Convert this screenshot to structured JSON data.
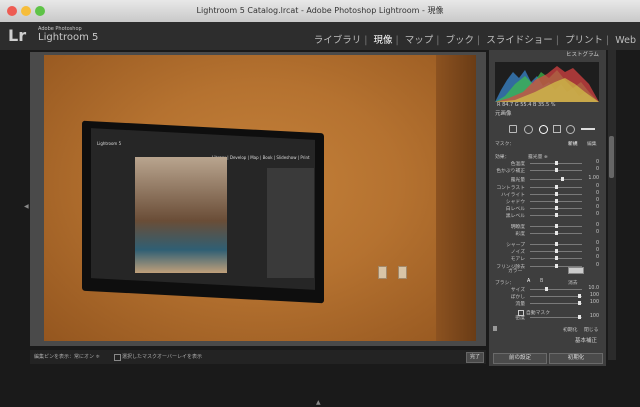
{
  "window": {
    "title": "Lightroom 5 Catalog.lrcat - Adobe Photoshop Lightroom - 現像"
  },
  "brand": {
    "small": "Adobe Photoshop",
    "big": "Lightroom 5",
    "logo": "Lr"
  },
  "modules": [
    "ライブラリ",
    "現像",
    "マップ",
    "ブック",
    "スライドショー",
    "プリント",
    "Web"
  ],
  "active_module": "現像",
  "panel": {
    "histogram_title": "ヒストグラム",
    "readout": "R 84.7  G 55.4  B 35.5 %",
    "smart_preview": "元画像",
    "mask_label": "マスク：",
    "mask_new": "新規",
    "mask_edit": "編集",
    "effect_label": "効果：",
    "effect_value": "露光量 ≑",
    "sliders": [
      {
        "label": "色温度",
        "value": "0"
      },
      {
        "label": "色かぶり補正",
        "value": "0"
      },
      {
        "label": "露光量",
        "value": "1.00"
      },
      {
        "label": "コントラスト",
        "value": "0"
      },
      {
        "label": "ハイライト",
        "value": "0"
      },
      {
        "label": "シャドウ",
        "value": "0"
      },
      {
        "label": "白レベル",
        "value": "0"
      },
      {
        "label": "黒レベル",
        "value": "0"
      },
      {
        "label": "明瞭度",
        "value": "0"
      },
      {
        "label": "彩度",
        "value": "0"
      },
      {
        "label": "シャープ",
        "value": "0"
      },
      {
        "label": "ノイズ",
        "value": "0"
      },
      {
        "label": "モアレ",
        "value": "0"
      },
      {
        "label": "フリンジ除去",
        "value": "0"
      }
    ],
    "color_label": "カラー",
    "brush_label": "ブラシ：",
    "brush_a": "A",
    "brush_b": "B",
    "brush_erase": "消去",
    "brush_rows": [
      {
        "label": "サイズ",
        "value": "10.0"
      },
      {
        "label": "ぼかし",
        "value": "100"
      },
      {
        "label": "流量",
        "value": "100"
      },
      {
        "label": "密度",
        "value": "100"
      }
    ],
    "auto_mask": "自動マスク",
    "reset": "初期化",
    "close": "閉じる",
    "basic": "基本補正",
    "prev_btn": "前の設定",
    "init_btn": "初期化"
  },
  "toolbar": {
    "show_pins": "編集ピンを表示：常にオン ≑",
    "show_overlay": "選択したマスクオーバーレイを表示",
    "done": "完了"
  },
  "tv_screen": {
    "title": "Lightroom 5",
    "modules": "Library | Develop | Map | Book | Slideshow | Print"
  }
}
